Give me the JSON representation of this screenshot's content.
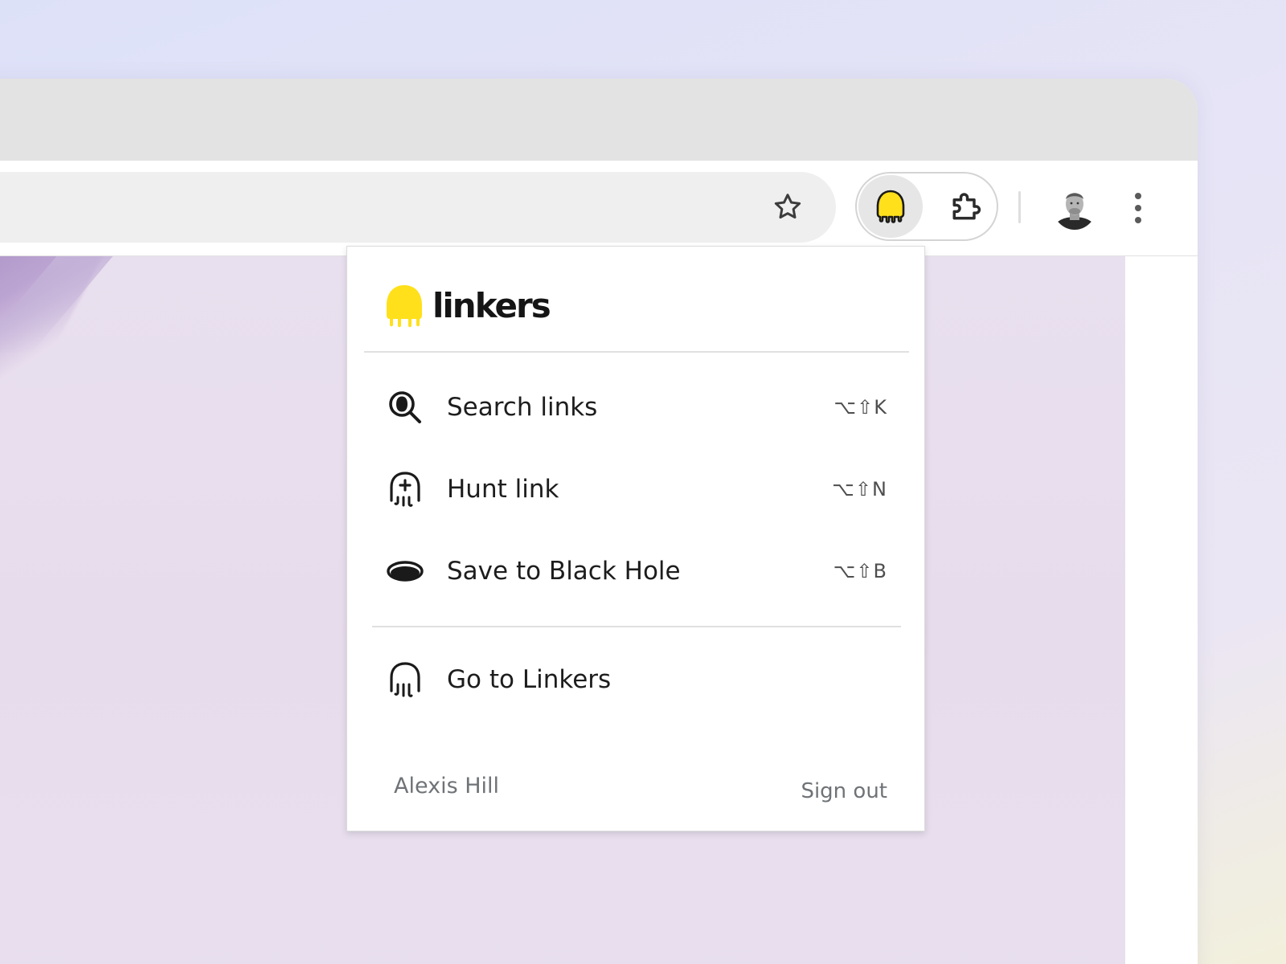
{
  "browser": {
    "bookmark_icon": "star-icon",
    "extensions": [
      {
        "name": "linkers-extension",
        "icon": "linkers-ghost-icon",
        "color": "#ffe01b",
        "active": true
      },
      {
        "name": "extensions-menu",
        "icon": "puzzle-icon"
      }
    ],
    "profile_icon": "avatar",
    "menu_icon": "kebab-icon"
  },
  "popup": {
    "brand": {
      "name": "linkers",
      "logo_color": "#ffe01b"
    },
    "menu": [
      {
        "id": "search",
        "label": "Search links",
        "shortcut": "⌥⇧K",
        "icon": "search-icon"
      },
      {
        "id": "hunt",
        "label": "Hunt link",
        "shortcut": "⌥⇧N",
        "icon": "ghost-plus-icon"
      },
      {
        "id": "blackhole",
        "label": "Save to Black Hole",
        "shortcut": "⌥⇧B",
        "icon": "black-hole-icon"
      }
    ],
    "secondary": [
      {
        "id": "goto",
        "label": "Go to Linkers",
        "icon": "ghost-icon"
      }
    ],
    "footer": {
      "user_name": "Alexis Hill",
      "sign_out_label": "Sign out"
    }
  }
}
